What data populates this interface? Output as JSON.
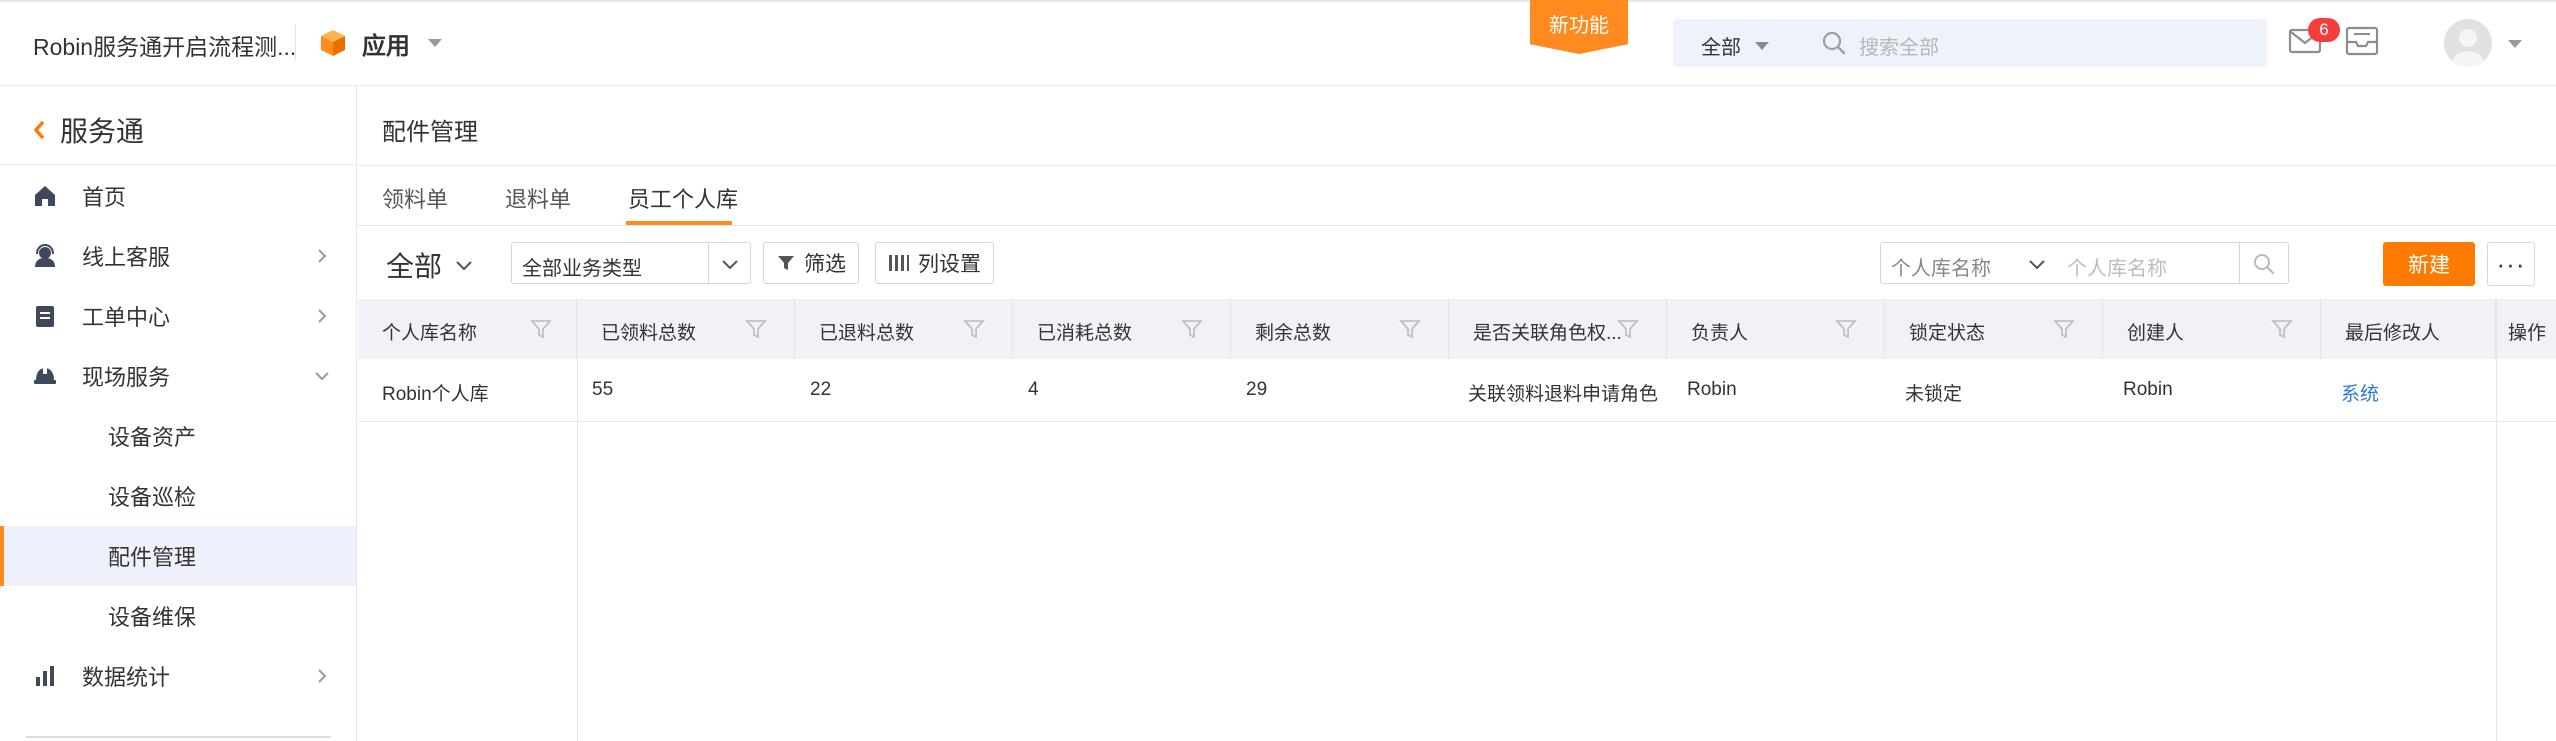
{
  "header": {
    "tenant_name": "Robin服务通开启流程测...",
    "app_name": "应用",
    "new_feature": "新功能",
    "search_scope": "全部",
    "search_placeholder": "搜索全部",
    "mail_badge": "6"
  },
  "sidebar": {
    "title": "服务通",
    "items": [
      {
        "label": "首页"
      },
      {
        "label": "线上客服"
      },
      {
        "label": "工单中心"
      },
      {
        "label": "现场服务"
      },
      {
        "label": "设备资产"
      },
      {
        "label": "设备巡检"
      },
      {
        "label": "配件管理"
      },
      {
        "label": "设备维保"
      },
      {
        "label": "数据统计"
      }
    ]
  },
  "main": {
    "page_title": "配件管理",
    "tabs": [
      {
        "label": "领料单"
      },
      {
        "label": "退料单"
      },
      {
        "label": "员工个人库"
      }
    ],
    "toolbar": {
      "scope": "全部",
      "biz_type": "全部业务类型",
      "filter_label": "筛选",
      "columns_label": "列设置",
      "search_field": "个人库名称",
      "search_placeholder": "个人库名称",
      "new_label": "新建",
      "more_label": "···"
    },
    "table": {
      "columns": [
        "个人库名称",
        "已领料总数",
        "已退料总数",
        "已消耗总数",
        "剩余总数",
        "是否关联角色权...",
        "负责人",
        "锁定状态",
        "创建人",
        "最后修改人",
        "操作"
      ],
      "rows": [
        [
          "Robin个人库",
          "55",
          "22",
          "4",
          "29",
          "关联领料退料申请角色",
          "Robin",
          "未锁定",
          "Robin",
          "系统"
        ]
      ]
    }
  },
  "colors": {
    "accent": "#ff8a1f",
    "primary_button": "#ff7a00",
    "link": "#2a79d8",
    "badge": "#f43e3e",
    "active_nav_bg": "#eef1fb"
  }
}
